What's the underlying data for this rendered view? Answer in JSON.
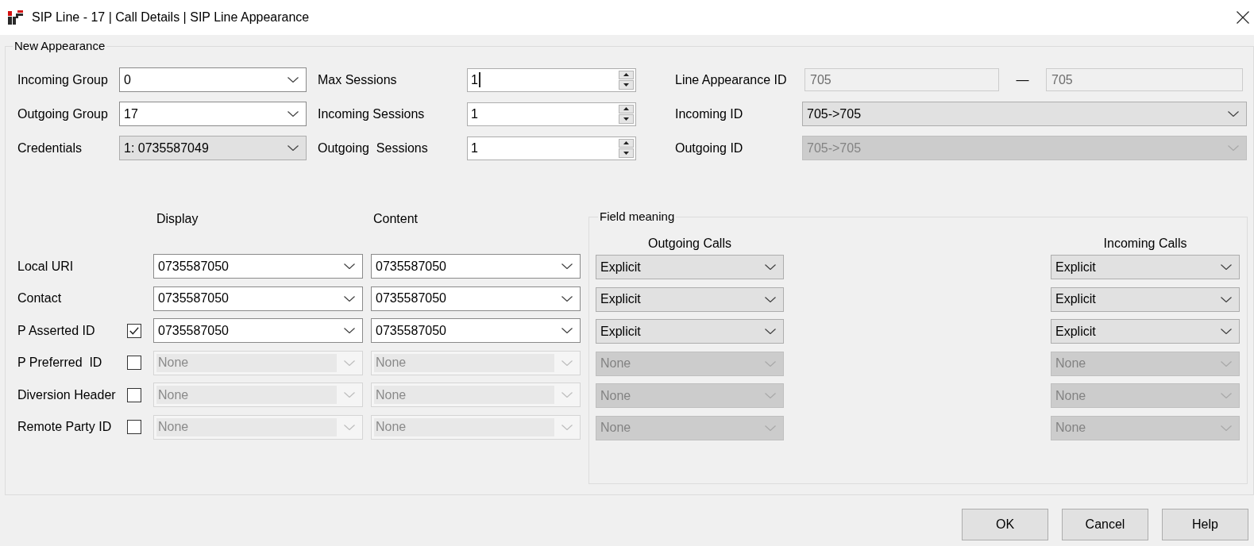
{
  "window": {
    "title": "SIP Line - 17 | Call Details | SIP Line Appearance"
  },
  "new_appearance": {
    "title": "New Appearance",
    "groups": [
      {
        "label": "Incoming Group",
        "field": {
          "kind": "editable",
          "value": "0",
          "disabled": false
        }
      },
      {
        "label": "Outgoing Group",
        "field": {
          "kind": "editable",
          "value": "17",
          "disabled": false
        }
      },
      {
        "label": "Credentials",
        "field": {
          "kind": "list",
          "value": "1: 0735587049",
          "disabled": false
        }
      }
    ],
    "sessions": [
      {
        "label": "Max Sessions",
        "value": "1",
        "focused": true
      },
      {
        "label": "Incoming Sessions",
        "value": "1",
        "focused": false
      },
      {
        "label": "Outgoing  Sessions",
        "value": "1",
        "focused": false
      }
    ],
    "line_appearance_id": {
      "label": "Line Appearance ID",
      "start": "705",
      "separator": "—",
      "end": "705",
      "readonly": true
    },
    "ids": [
      {
        "label": "Incoming ID",
        "field": {
          "kind": "list",
          "value": "705->705",
          "disabled": false
        }
      },
      {
        "label": "Outgoing ID",
        "field": {
          "kind": "list",
          "value": "705->705",
          "disabled": true
        }
      }
    ],
    "headers": {
      "columns": [
        "Display",
        "Content"
      ],
      "rows": [
        {
          "label": "Local URI",
          "kind": "plain",
          "display": {
            "kind": "editable",
            "value": "0735587050",
            "disabled": false
          },
          "content": {
            "kind": "editable",
            "value": "0735587050",
            "disabled": false
          }
        },
        {
          "label": "Contact",
          "kind": "plain",
          "display": {
            "kind": "editable",
            "value": "0735587050",
            "disabled": false
          },
          "content": {
            "kind": "editable",
            "value": "0735587050",
            "disabled": false
          }
        },
        {
          "label": "P Asserted ID",
          "kind": "optional",
          "checked": true,
          "display": {
            "kind": "editable",
            "value": "0735587050",
            "disabled": false
          },
          "content": {
            "kind": "editable",
            "value": "0735587050",
            "disabled": false
          }
        },
        {
          "label": "P Preferred  ID",
          "kind": "optional",
          "checked": false,
          "display": {
            "kind": "editable",
            "value": "None",
            "disabled": true
          },
          "content": {
            "kind": "editable",
            "value": "None",
            "disabled": true
          }
        },
        {
          "label": "Diversion Header",
          "kind": "optional",
          "checked": false,
          "display": {
            "kind": "editable",
            "value": "None",
            "disabled": true
          },
          "content": {
            "kind": "editable",
            "value": "None",
            "disabled": true
          }
        },
        {
          "label": "Remote Party ID",
          "kind": "optional",
          "checked": false,
          "display": {
            "kind": "editable",
            "value": "None",
            "disabled": true
          },
          "content": {
            "kind": "editable",
            "value": "None",
            "disabled": true
          }
        }
      ]
    },
    "field_meaning": {
      "title": "Field meaning",
      "columns": [
        "Outgoing Calls",
        "Incoming Calls"
      ],
      "rows": [
        {
          "outgoing": {
            "kind": "list",
            "value": "Explicit",
            "disabled": false
          },
          "incoming": {
            "kind": "list",
            "value": "Explicit",
            "disabled": false
          }
        },
        {
          "outgoing": {
            "kind": "list",
            "value": "Explicit",
            "disabled": false
          },
          "incoming": {
            "kind": "list",
            "value": "Explicit",
            "disabled": false
          }
        },
        {
          "outgoing": {
            "kind": "list",
            "value": "Explicit",
            "disabled": false
          },
          "incoming": {
            "kind": "list",
            "value": "Explicit",
            "disabled": false
          }
        },
        {
          "outgoing": {
            "kind": "list",
            "value": "None",
            "disabled": true
          },
          "incoming": {
            "kind": "list",
            "value": "None",
            "disabled": true
          }
        },
        {
          "outgoing": {
            "kind": "list",
            "value": "None",
            "disabled": true
          },
          "incoming": {
            "kind": "list",
            "value": "None",
            "disabled": true
          }
        },
        {
          "outgoing": {
            "kind": "list",
            "value": "None",
            "disabled": true
          },
          "incoming": {
            "kind": "list",
            "value": "None",
            "disabled": true
          }
        }
      ]
    }
  },
  "buttons": [
    "OK",
    "Cancel",
    "Help"
  ]
}
